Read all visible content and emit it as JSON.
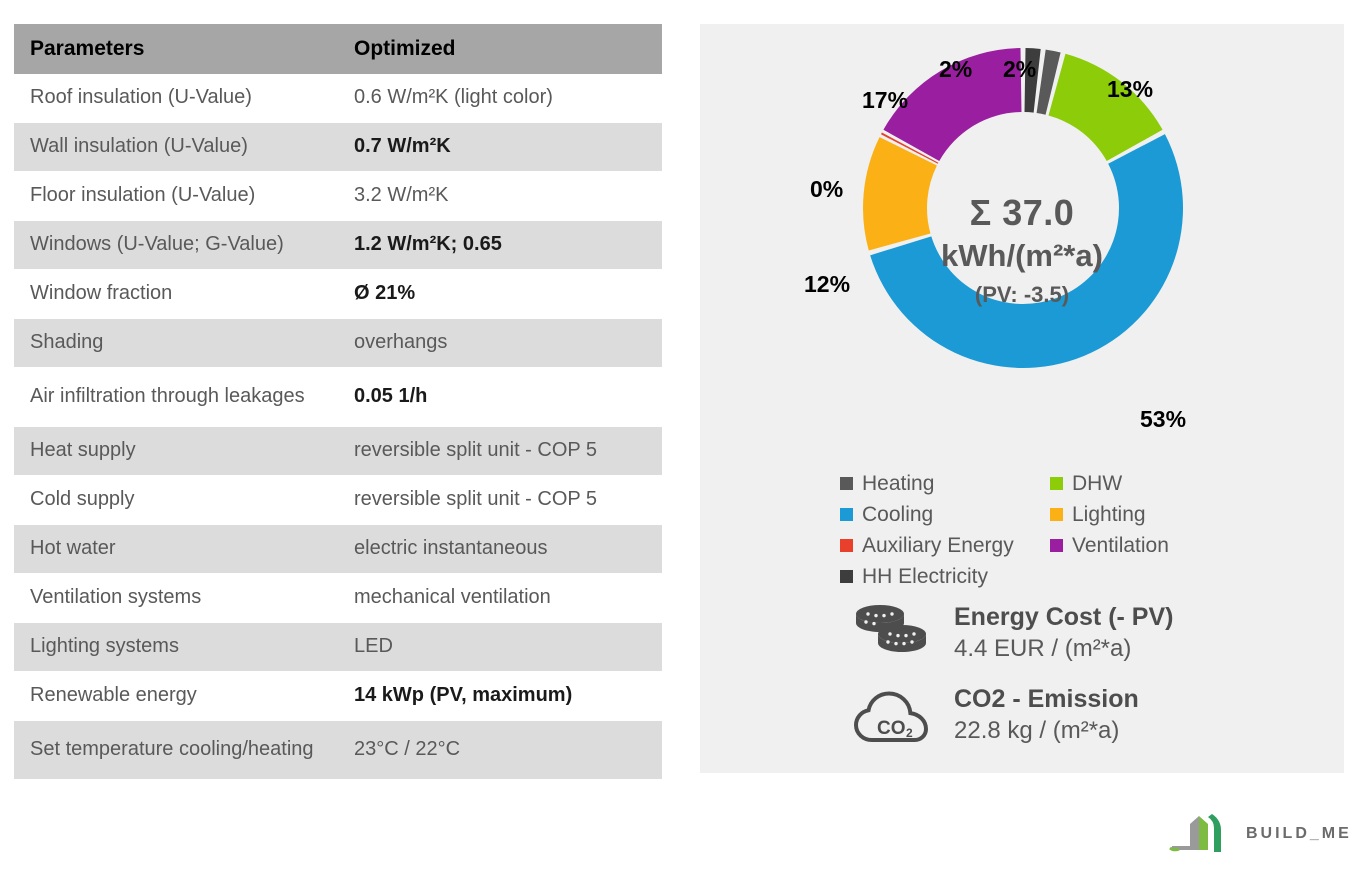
{
  "table": {
    "columns": [
      "Parameters",
      "Optimized"
    ],
    "rows": [
      {
        "param": "Roof insulation (U-Value)",
        "value": "0.6 W/m²K (light color)",
        "bold": false
      },
      {
        "param": "Wall insulation (U-Value)",
        "value": "0.7 W/m²K",
        "bold": true
      },
      {
        "param": "Floor insulation (U-Value)",
        "value": "3.2 W/m²K",
        "bold": false
      },
      {
        "param": "Windows (U-Value; G-Value)",
        "value": "1.2 W/m²K; 0.65",
        "bold": true
      },
      {
        "param": "Window fraction",
        "value": "Ø 21%",
        "bold": true
      },
      {
        "param": "Shading",
        "value": "overhangs",
        "bold": false
      },
      {
        "param": "Air infiltration through leakages",
        "value": "0.05 1/h",
        "bold": true
      },
      {
        "param": "Heat supply",
        "value": "reversible split unit - COP 5",
        "bold": false
      },
      {
        "param": "Cold supply",
        "value": "reversible split unit - COP 5",
        "bold": false
      },
      {
        "param": "Hot water",
        "value": "electric instantaneous",
        "bold": false
      },
      {
        "param": "Ventilation systems",
        "value": "mechanical ventilation",
        "bold": false
      },
      {
        "param": "Lighting systems",
        "value": "LED",
        "bold": false
      },
      {
        "param": "Renewable energy",
        "value": "14 kWp (PV, maximum)",
        "bold": true
      },
      {
        "param": "Set temperature cooling/heating",
        "value": "23°C / 22°C",
        "bold": false
      }
    ]
  },
  "chart_data": {
    "type": "pie",
    "title": "",
    "center_sum": "Σ 37.0",
    "center_unit": "kWh/(m²*a)",
    "center_pv": "(PV: -3.5)",
    "total": 37.0,
    "pv": -3.5,
    "unit": "kWh/(m²*a)",
    "legend_position": "below",
    "categories": [
      "HH Electricity",
      "Heating",
      "DHW",
      "Cooling",
      "Lighting",
      "Auxiliary Energy",
      "Ventilation"
    ],
    "values": [
      2,
      2,
      13,
      53,
      12,
      0,
      17
    ],
    "labels": [
      "2%",
      "2%",
      "13%",
      "53%",
      "12%",
      "0%",
      "17%"
    ],
    "colors": [
      "#3d3d3d",
      "#595959",
      "#8ccc09",
      "#1b9ad6",
      "#fbb116",
      "#e8402a",
      "#9a1fa0"
    ],
    "legend": [
      {
        "label": "Heating",
        "color": "#595959"
      },
      {
        "label": "DHW",
        "color": "#8ccc09"
      },
      {
        "label": "Cooling",
        "color": "#1b9ad6"
      },
      {
        "label": "Lighting",
        "color": "#fbb116"
      },
      {
        "label": "Auxiliary Energy",
        "color": "#e8402a"
      },
      {
        "label": "Ventilation",
        "color": "#9a1fa0"
      },
      {
        "label": "HH Electricity",
        "color": "#3d3d3d"
      }
    ]
  },
  "kpi": {
    "cost": {
      "title": "Energy Cost (- PV)",
      "value": "4.4 EUR / (m²*a)"
    },
    "co2": {
      "title": "CO2 - Emission",
      "value": "22.8 kg / (m²*a)"
    }
  },
  "logo": {
    "text": "BUILD_ME"
  }
}
